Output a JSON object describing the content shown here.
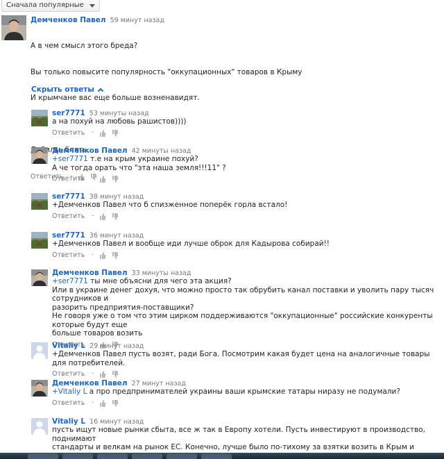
{
  "sort": {
    "label": "Сначала популярные"
  },
  "hide_replies": "Скрыть ответы",
  "reply_label": "Ответить",
  "top_comment": {
    "author": "Демченков Павел",
    "time": "59 минут назад",
    "lines": [
      "А в чем смысл этого бреда?",
      "Вы только повысите популярность \"оккупационных\" товаров в Крыму",
      "И крымчане вас еще больше возненавидят.",
      "",
      "Дебилы, блять..."
    ]
  },
  "replies": [
    {
      "author": "ser7771",
      "time": "53 минуты назад",
      "mention": "",
      "text": "а на похуй на любовь рашистов))))",
      "avatar": "landscape"
    },
    {
      "author": "Демченков Павел",
      "time": "42 минуты назад",
      "mention": "+ser7771",
      "text": " т.е на крым украине похуй?\nА че тогда орать что \"эта наша земля!!!11\" ?",
      "avatar": "person"
    },
    {
      "author": "ser7771",
      "time": "38 минут назад",
      "mention": "",
      "text": "+Демченков Павел что б спизженное поперёк горла встало!",
      "avatar": "landscape"
    },
    {
      "author": "ser7771",
      "time": "36 минут назад",
      "mention": "",
      "text": "+Демченков Павел и вообще иди лучше оброк для Кадырова собирай!!",
      "avatar": "landscape"
    },
    {
      "author": "Демченков Павел",
      "time": "33 минуты назад",
      "mention": "+ser7771",
      "text": " ты мне объясни для чего эта акция?\nИли в украине денег дохуя, что можно просто так обрубить канал поставки и уволить пару тысяч сотрудников и\nразорить предприятия-поставщики?\nНе говоря уже о том что этим цирком поддерживаются \"оккупационные\" российские конкуренты которые будут еще\nбольше товаров возить",
      "avatar": "person"
    },
    {
      "author": "Vitaliy L",
      "time": "29 минут назад",
      "mention": "",
      "text": "+Демченков Павел пусть возят, ради Бога. Посмотрим какая будет цена на аналогичные товары для потребителей.",
      "avatar": "default"
    },
    {
      "author": "Демченков Павел",
      "time": "27 минут назад",
      "mention": "+Vitaliy L",
      "text": " а про предпринимателей украины ваши крымские татары ниразу не подумали?",
      "avatar": "person"
    },
    {
      "author": "Vitaliy L",
      "time": "16 минут назад",
      "mention": "",
      "text": "пусть ищут новые рынки сбыта, все ж так в Европу хотели. Пусть инвестируют в производство, поднимают\nстандарты и велкам на рынок ЕС. Конечно, лучше было по-тихому за взятки возить в Крым и снимать бешеную\nприбыль.",
      "avatar": "default"
    }
  ]
}
